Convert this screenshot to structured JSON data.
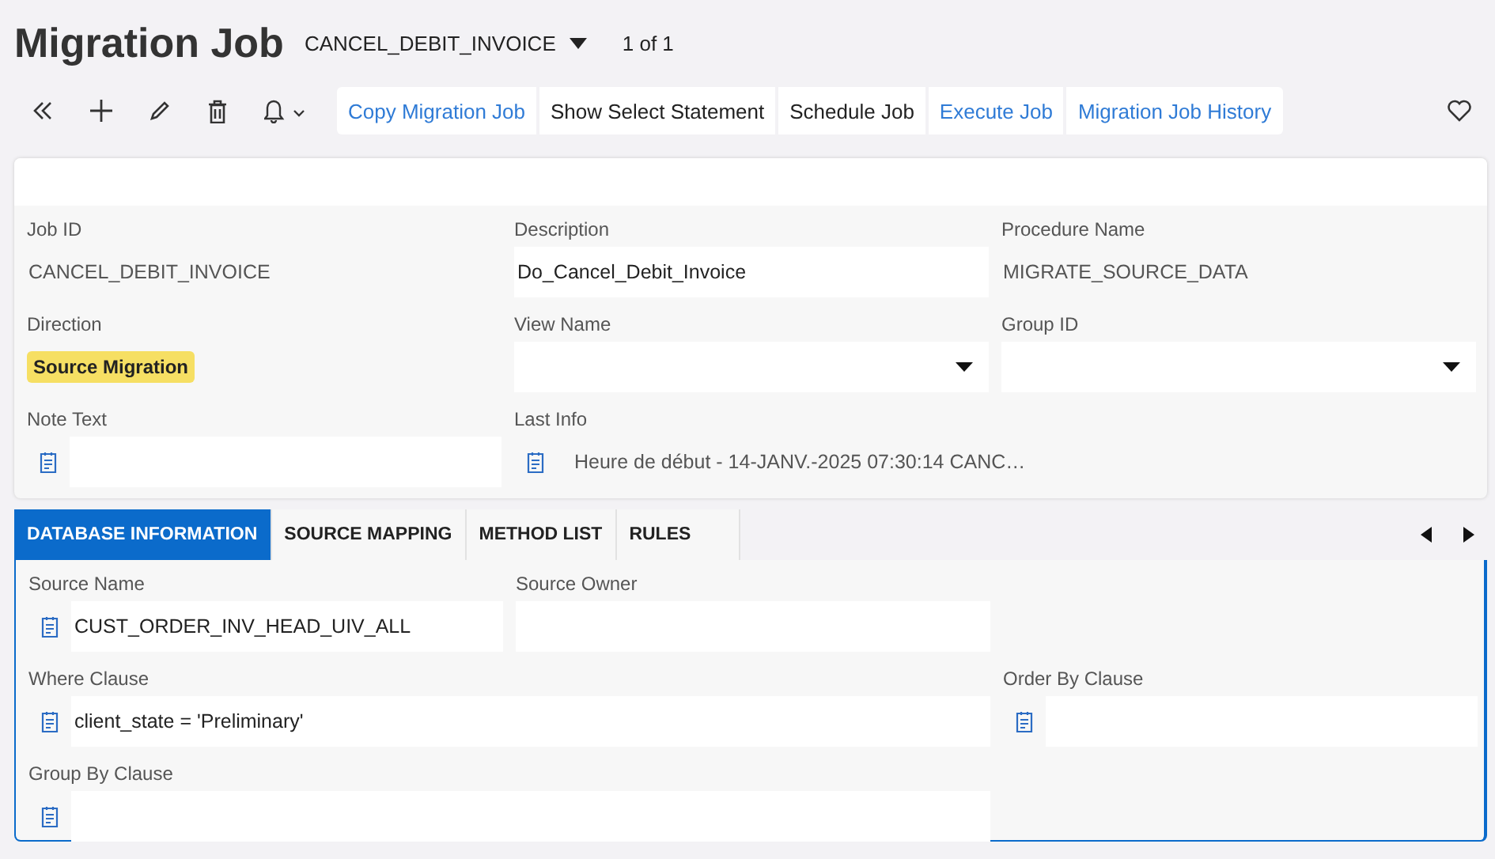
{
  "header": {
    "title": "Migration Job",
    "record": "CANCEL_DEBIT_INVOICE",
    "counter": "1 of 1"
  },
  "toolbar": {
    "commands": [
      {
        "label": "Copy Migration Job",
        "kind": "link"
      },
      {
        "label": "Show Select Statement",
        "kind": "command"
      },
      {
        "label": "Schedule Job",
        "kind": "command"
      },
      {
        "label": "Execute Job",
        "kind": "link"
      },
      {
        "label": "Migration Job History",
        "kind": "link"
      }
    ]
  },
  "fields": [
    {
      "label": "Job ID",
      "kind": "readonly",
      "value": "CANCEL_DEBIT_INVOICE"
    },
    {
      "label": "Description",
      "kind": "input",
      "value": "Do_Cancel_Debit_Invoice"
    },
    {
      "label": "Procedure Name",
      "kind": "readonly",
      "value": "MIGRATE_SOURCE_DATA"
    },
    {
      "label": "Direction",
      "kind": "badge",
      "value": "Source Migration"
    },
    {
      "label": "View Name",
      "kind": "select"
    },
    {
      "label": "Group ID",
      "kind": "select"
    },
    {
      "label": "Note Text",
      "kind": "note"
    },
    {
      "label": "Last Info",
      "kind": "info",
      "value": "Heure de début - 14-JANV.-2025 07:30:14 CANC…"
    }
  ],
  "tabs": [
    {
      "label": "DATABASE INFORMATION",
      "selected": true
    },
    {
      "label": "SOURCE MAPPING",
      "selected": false
    },
    {
      "label": "METHOD LIST",
      "selected": false
    },
    {
      "label": "RULES",
      "selected": false
    }
  ],
  "tab_fields": [
    {
      "label": "Source Name",
      "kind": "note",
      "value": "CUST_ORDER_INV_HEAD_UIV_ALL"
    },
    {
      "label": "Source Owner",
      "kind": "input"
    },
    {
      "label": "Where Clause",
      "kind": "note",
      "value": "client_state = 'Preliminary'",
      "wide": true
    },
    {
      "label": "Order By Clause",
      "kind": "note"
    },
    {
      "label": "Group By Clause",
      "kind": "note",
      "wide": true
    }
  ]
}
